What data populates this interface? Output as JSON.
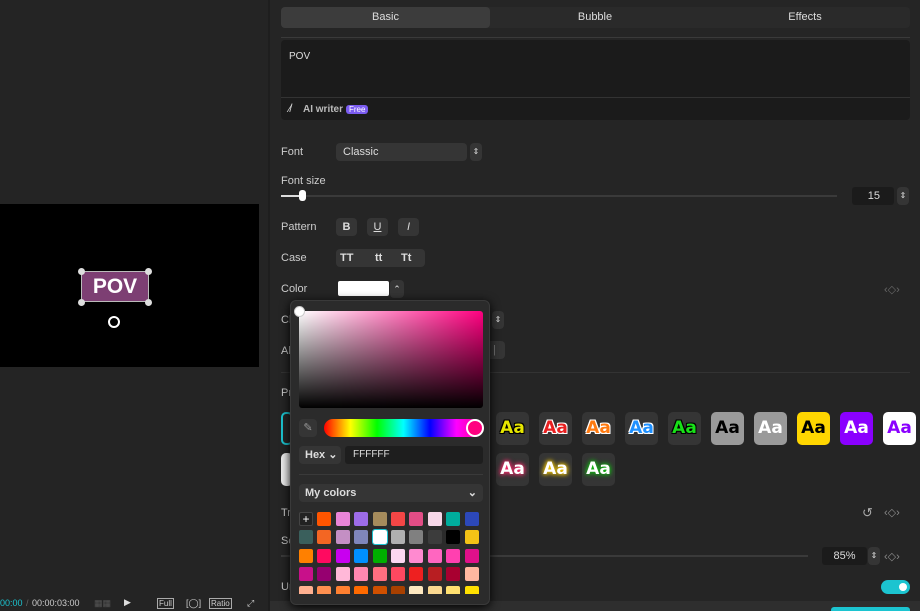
{
  "preview": {
    "caption": "POV",
    "current_time": "00:00",
    "total_time": "00:00:03:00",
    "full_label": "Full",
    "ratio_label": "Ratio"
  },
  "tabs": [
    {
      "label": "Basic",
      "active": true
    },
    {
      "label": "Bubble"
    },
    {
      "label": "Effects"
    }
  ],
  "text_input": {
    "value": "POV"
  },
  "ai_writer": {
    "label": "AI writer",
    "badge": "Free"
  },
  "font": {
    "label": "Font",
    "value": "Classic"
  },
  "font_size": {
    "label": "Font size",
    "value": "15",
    "slider_fraction": 0.04
  },
  "pattern": {
    "label": "Pattern",
    "buttons": [
      "B",
      "U",
      "I"
    ]
  },
  "case": {
    "label": "Case",
    "options": [
      "TT",
      "tt",
      "Tt"
    ]
  },
  "color": {
    "label": "Color",
    "value": "#FFFFFF"
  },
  "hidden_labels": [
    "Ch",
    "Al",
    "Pr",
    "Tr",
    "Sc",
    "Ur"
  ],
  "presets": [
    {
      "label": "Aa",
      "fg": "#e6e600",
      "bg": "#353535",
      "stroke": "#000"
    },
    {
      "label": "Aa",
      "fg": "#e82020",
      "bg": "#353535",
      "stroke": "#fff"
    },
    {
      "label": "Aa",
      "fg": "#ff7a10",
      "bg": "#353535",
      "stroke": "#fff"
    },
    {
      "label": "Aa",
      "fg": "#1e90ff",
      "bg": "#353535",
      "stroke": "#fff"
    },
    {
      "label": "Aa",
      "fg": "#18e018",
      "bg": "#353535",
      "stroke": "#000"
    },
    {
      "label": "Aa",
      "fg": "#000",
      "bg": "#9a9a9a",
      "stroke": "none"
    },
    {
      "label": "Aa",
      "fg": "#fff",
      "bg": "#9a9a9a",
      "stroke": "none"
    },
    {
      "label": "Aa",
      "fg": "#000",
      "bg": "#ffd600",
      "stroke": "none"
    },
    {
      "label": "Aa",
      "fg": "#fff",
      "bg": "#8a00ff",
      "stroke": "none"
    },
    {
      "label": "Aa",
      "fg": "#8a00ff",
      "bg": "#ffffff",
      "stroke": "none"
    },
    {
      "label": "Aa",
      "fg": "#fff",
      "bg": "#353535",
      "glow": "#ff2a6d"
    },
    {
      "label": "Aa",
      "fg": "#fff",
      "bg": "#353535",
      "glow": "#ffd000"
    },
    {
      "label": "Aa",
      "fg": "#fff",
      "bg": "#353535",
      "glow": "#10c010"
    }
  ],
  "scale": {
    "value": "85%"
  },
  "picker": {
    "mode": "Hex",
    "hex": "FFFFFF",
    "section": "My colors",
    "hue_color": "#ff0080",
    "swatches": [
      "#ff5500",
      "#e985d8",
      "#9d6ce8",
      "#a68c5c",
      "#f44646",
      "#e24d86",
      "#f7d7e8",
      "#00ad9d",
      "#2c48b9",
      "#3a5f5c",
      "#f36623",
      "#c48fc4",
      "#7f86bb",
      "#ffffff",
      "#b0b0b0",
      "#808080",
      "#3c3c3c",
      "#000000",
      "#f3c316",
      "#ff8000",
      "#ff0a60",
      "#c800f0",
      "#0090ff",
      "#00b000",
      "#fcd7f0",
      "#ff8ad0",
      "#ff66c0",
      "#ff40b0",
      "#e0108a",
      "#c8108a",
      "#960070",
      "#ffb8d8",
      "#ff88b0",
      "#ff6f80",
      "#ff4860",
      "#ee2020",
      "#b81e22",
      "#a80030",
      "#ffb8a0",
      "#ffb090",
      "#ff9050",
      "#ff8030",
      "#ff6a00",
      "#d05000",
      "#a84000",
      "#fde8c0",
      "#fad890",
      "#ffe070",
      "#ffe000"
    ]
  }
}
